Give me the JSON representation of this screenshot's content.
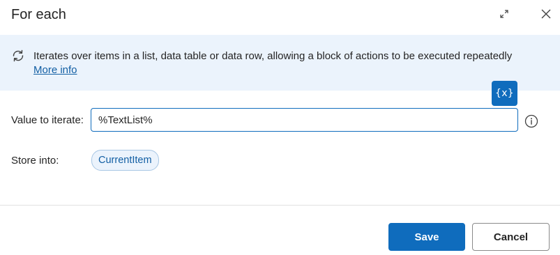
{
  "dialog": {
    "title": "For each"
  },
  "banner": {
    "icon": "loop-icon",
    "description": "Iterates over items in a list, data table or data row, allowing a block of actions to be executed repeatedly",
    "more_info_link": "More info"
  },
  "variables_button": {
    "label": "{x}"
  },
  "fields": {
    "value_to_iterate": {
      "label": "Value to iterate:",
      "value": "%TextList%"
    },
    "store_into": {
      "label": "Store into:",
      "variable": "CurrentItem"
    }
  },
  "footer": {
    "save_label": "Save",
    "cancel_label": "Cancel"
  },
  "colors": {
    "accent": "#0f6cbd",
    "banner_bg": "#ebf3fc",
    "link": "#115ea3"
  }
}
